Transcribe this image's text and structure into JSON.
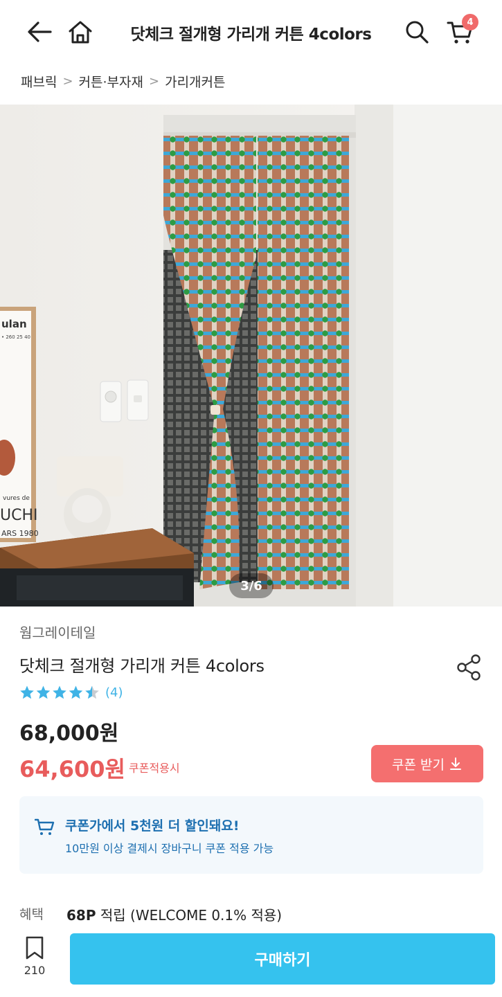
{
  "header": {
    "title": "닷체크 절개형 가리개 커튼 4colors",
    "cart_count": "4",
    "back_icon": "arrow-left-icon",
    "home_icon": "home-icon",
    "search_icon": "search-icon",
    "cart_icon": "cart-icon"
  },
  "breadcrumb": {
    "items": [
      "패브릭",
      "커튼·부자재",
      "가리개커튼"
    ],
    "separator": ">"
  },
  "image": {
    "counter": "3/6",
    "poster_lines": [
      "ulan",
      "• 260 25 40",
      "vures de",
      "UCHI",
      "ARS 1980"
    ]
  },
  "product": {
    "brand": "웜그레이테일",
    "name": "닷체크 절개형 가리개 커튼 4colors",
    "rating": 4.5,
    "rating_count": "(4)",
    "original_price": "68,000원",
    "sale_price": "64,600원",
    "coupon_note": "쿠폰적용시",
    "coupon_button": "쿠폰 받기",
    "share_icon": "share-icon"
  },
  "coupon_box": {
    "title": "쿠폰가에서 5천원 더 할인돼요!",
    "subtitle": "10만원 이상 결제시 장바구니 쿠폰 적용 가능"
  },
  "benefit": {
    "label": "혜택",
    "points": "68P",
    "text": " 적립 (WELCOME 0.1% 적용)"
  },
  "bottom_bar": {
    "wishlist_count": "210",
    "buy_label": "구매하기"
  },
  "colors": {
    "accent_blue": "#35c2ee",
    "coupon_red": "#f46f6f",
    "price_red": "#e85c5c",
    "star_blue": "#3fb3e6"
  }
}
